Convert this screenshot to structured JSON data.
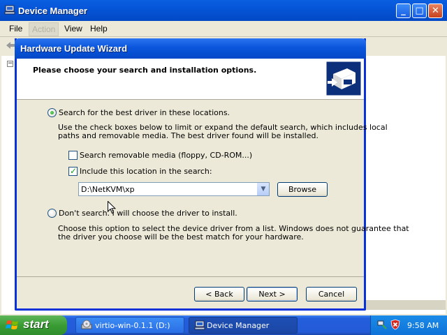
{
  "device_manager": {
    "title": "Device Manager",
    "menu": {
      "file": "File",
      "action": "Action",
      "view": "View",
      "help": "Help"
    },
    "tree_expander": "−"
  },
  "wizard": {
    "title": "Hardware Update Wizard",
    "heading": "Please choose your search and installation options.",
    "option_search": {
      "label": "Search for the best driver in these locations.",
      "selected": true,
      "description_line1": "Use the check boxes below to limit or expand the default search, which includes local",
      "description_line2": "paths and removable media. The best driver found will be installed."
    },
    "check_removable": {
      "label": "Search removable media (floppy, CD-ROM...)",
      "checked": false
    },
    "check_location": {
      "label": "Include this location in the search:",
      "checked": true
    },
    "location_value": "D:\\NetKVM\\xp",
    "browse_label": "Browse",
    "option_dont_search": {
      "label": "Don't search. I will choose the driver to install.",
      "selected": false,
      "description_line1": "Choose this option to select the device driver from a list.  Windows does not guarantee that",
      "description_line2": "the driver you choose will be the best match for your hardware."
    },
    "buttons": {
      "back": "< Back",
      "next": "Next >",
      "cancel": "Cancel"
    }
  },
  "taskbar": {
    "start_label": "start",
    "tasks": [
      "virtio-win-0.1.1 (D:)",
      "Device Manager"
    ],
    "clock": "9:58 AM"
  },
  "colors": {
    "title_blue": "#0a56dc",
    "dialog_face": "#ece9d8",
    "start_green": "#3a9c35",
    "taskbar_blue": "#245edc"
  }
}
